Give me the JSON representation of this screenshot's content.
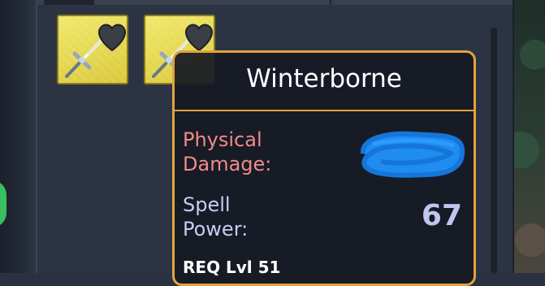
{
  "inventory": {
    "slots": [
      {
        "item_icon": "sword-icon",
        "badge_icon": "heart-icon"
      },
      {
        "item_icon": "sword-icon",
        "badge_icon": "heart-icon"
      }
    ]
  },
  "tooltip": {
    "title": "Winterborne",
    "physical_damage": {
      "label_line1": "Physical",
      "label_line2": "Damage:",
      "value_hidden": true
    },
    "spell_power": {
      "label_line1": "Spell",
      "label_line2": "Power:",
      "value": "67"
    },
    "requirement": "REQ Lvl   51"
  },
  "colors": {
    "slot_fill": "#e8dc55",
    "tooltip_border": "#e2a43b",
    "physical_label": "#f08a8a",
    "spell_label": "#c7cdf2",
    "redaction_scribble": "#1f8cf0"
  }
}
